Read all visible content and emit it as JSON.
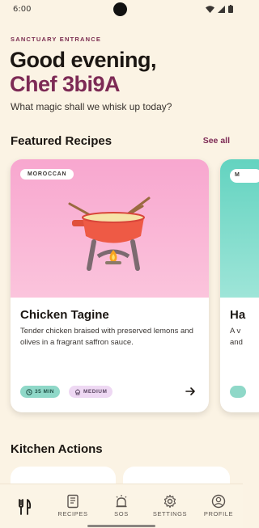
{
  "status_bar": {
    "time": "6:00"
  },
  "header": {
    "eyebrow": "SANCTUARY ENTRANCE",
    "greeting": "Good evening,",
    "name": "Chef 3bi9A",
    "subtitle": "What magic shall we whisk up today?"
  },
  "featured": {
    "title": "Featured Recipes",
    "see_all": "See all",
    "cards": [
      {
        "tag": "MOROCCAN",
        "title": "Chicken Tagine",
        "description": "Tender chicken braised with preserved lemons and olives in a fragrant saffron sauce.",
        "time": "35 MIN",
        "difficulty": "MEDIUM",
        "hero_color": "#f8a7cf"
      },
      {
        "tag": "M",
        "title": "Ha",
        "description": "A v\nand",
        "hero_color": "#63d3c0"
      }
    ]
  },
  "kitchen": {
    "title": "Kitchen Actions"
  },
  "nav": {
    "items": [
      {
        "label": "",
        "icon": "fork-knife-icon"
      },
      {
        "label": "RECIPES",
        "icon": "book-icon"
      },
      {
        "label": "SOS",
        "icon": "alarm-bell-icon"
      },
      {
        "label": "SETTINGS",
        "icon": "gear-icon"
      },
      {
        "label": "PROFILE",
        "icon": "user-circle-icon"
      }
    ]
  },
  "colors": {
    "background": "#fbf3e4",
    "accent": "#7d2a55",
    "teal": "#8fd8c8"
  }
}
